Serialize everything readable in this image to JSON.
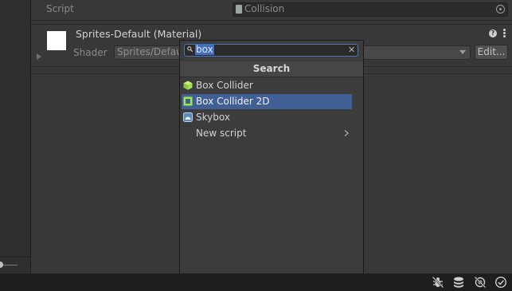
{
  "inspector": {
    "script_label": "Script",
    "script_value": "Collision",
    "material_name": "Sprites-Default (Material)",
    "shader_label": "Shader",
    "shader_value": "Sprites/Defau",
    "edit_button_label": "Edit..."
  },
  "popup": {
    "search_value": "box",
    "header": "Search",
    "results": [
      {
        "label": "Box Collider",
        "icon": "cube-icon"
      },
      {
        "label": "Box Collider 2D",
        "icon": "box-collider-2d-icon",
        "selected": true
      },
      {
        "label": "Skybox",
        "icon": "skybox-icon"
      },
      {
        "label": "New script",
        "icon": "chevron-right-icon"
      }
    ]
  },
  "toolbar_icons": [
    "debug-off-icon",
    "layers-icon",
    "lighting-off-icon",
    "check-circle-icon"
  ],
  "colors": {
    "selection": "#3f5f95",
    "search_highlight": "#3f6fc0",
    "panel_bg": "#383838",
    "popup_bg": "#3c3c3c"
  }
}
